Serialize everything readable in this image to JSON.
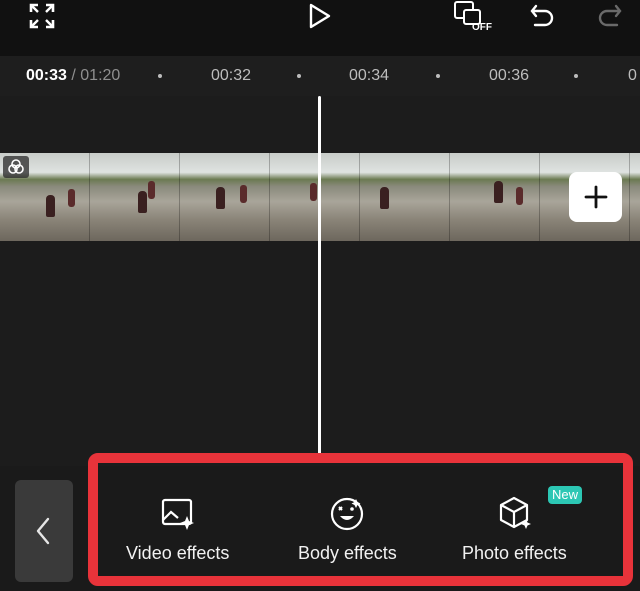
{
  "toolbar_top": {
    "icons": [
      "fullscreen-icon",
      "play-icon",
      "sync-off-icon",
      "undo-icon",
      "redo-icon"
    ],
    "sync_off_label": "OFF"
  },
  "timeline_header": {
    "current_time": "00:33",
    "total_time": "/ 01:20",
    "ticks": [
      "00:32",
      "00:34",
      "00:36"
    ]
  },
  "clip": {
    "add_icon": "plus-icon",
    "badge_icon": "overlay-icon"
  },
  "bottom_toolbar": {
    "back_icon": "chevron-left-icon",
    "options": [
      {
        "label": "Video effects",
        "icon": "video-effects-icon"
      },
      {
        "label": "Body effects",
        "icon": "body-effects-icon"
      },
      {
        "label": "Photo effects",
        "icon": "photo-effects-icon",
        "badge": "New"
      }
    ]
  },
  "colors": {
    "highlight": "#e8333a",
    "new_badge": "#2cc7b4",
    "background": "#1e1e1e"
  }
}
